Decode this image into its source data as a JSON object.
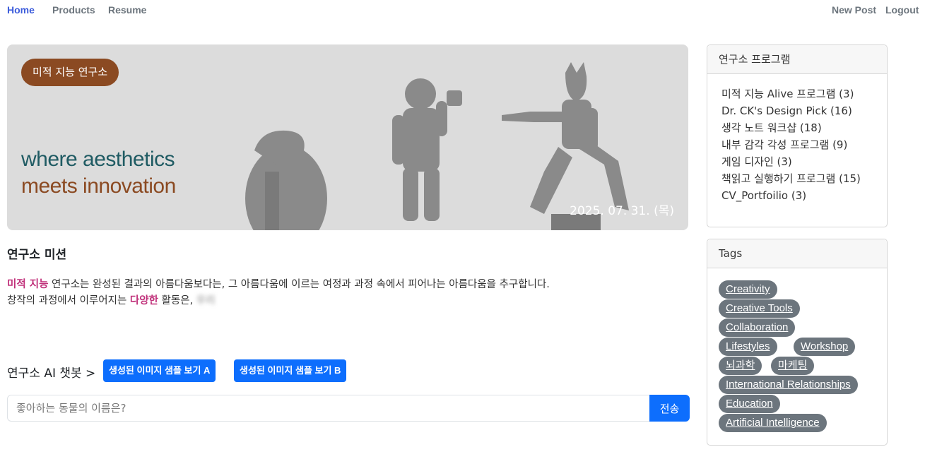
{
  "nav": {
    "home": "Home",
    "products": "Products",
    "resume": "Resume",
    "new_post": "New Post",
    "logout": "Logout"
  },
  "hero": {
    "badge": "미적 지능 연구소",
    "line1": "where aesthetics",
    "line2": "meets innovation",
    "date": "2025. 07. 31. (목)"
  },
  "mission": {
    "title": "연구소 미션",
    "hl1": "미적 지능",
    "text1": " 연구소는 완성된 결과의 아름다움보다는, 그 아름다움에 이르는 여정과 과정 속에서 피어나는 아름다움을 추구합니다.",
    "text2": "창작의 과정에서 이루어지는 ",
    "hl2": "다양한",
    "text3": " 활동은, ",
    "text4": "우리"
  },
  "chatbot": {
    "title": "연구소 AI 챗봇 >",
    "sample_a": "생성된 이미지 샘플 보기 A",
    "sample_b": "생성된 이미지 샘플 보기 B",
    "placeholder": "좋아하는 동물의 이름은?",
    "send": "전송"
  },
  "programs": {
    "title": "연구소 프로그램",
    "items": [
      "미적 지능 Alive 프로그램 (3)",
      "Dr. CK's Design Pick (16)",
      "생각 노트 워크샵 (18)",
      "내부 감각 각성 프로그램 (9)",
      "게임 디자인 (3)",
      "책읽고 실행하기 프로그램 (15)",
      "CV_Portfoilio (3)"
    ]
  },
  "tags": {
    "title": "Tags",
    "items": [
      "Creativity",
      "Creative Tools",
      "Collaboration",
      "Lifestyles",
      "Workshop",
      "뇌과학",
      "마케팅",
      "International Relationships",
      "Education",
      "Artificial Intelligence"
    ]
  },
  "colors": {
    "accent": "#0d6efd",
    "brand_brown": "#8b4a22",
    "brand_teal": "#1f5b63",
    "highlight": "#c0307a",
    "tag_bg": "#6c757d"
  }
}
